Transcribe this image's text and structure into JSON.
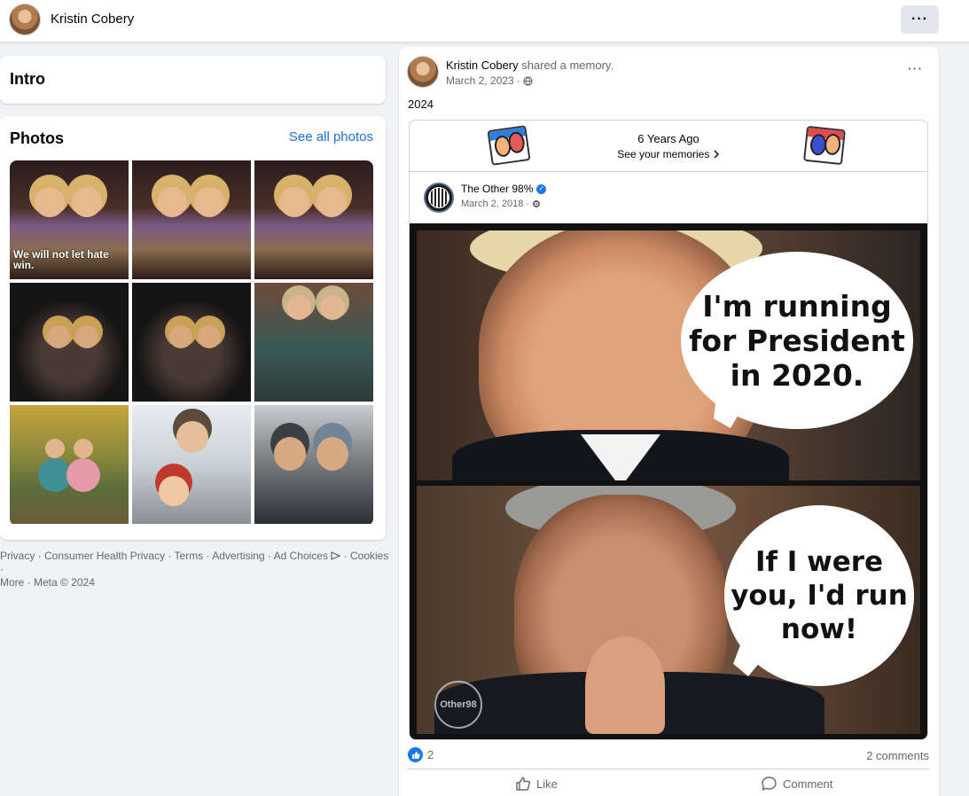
{
  "header": {
    "profile_name": "Kristin Cobery",
    "more_label": "···"
  },
  "intro": {
    "title": "Intro"
  },
  "photos": {
    "title": "Photos",
    "see_all": "See all photos",
    "items": [
      {
        "caption": "We will not let hate win."
      },
      {
        "caption": ""
      },
      {
        "caption": ""
      },
      {
        "caption": ""
      },
      {
        "caption": ""
      },
      {
        "caption": ""
      },
      {
        "caption": ""
      },
      {
        "caption": ""
      },
      {
        "caption": ""
      }
    ]
  },
  "footer": {
    "links": [
      "Privacy",
      "Consumer Health Privacy",
      "Terms",
      "Advertising",
      "Ad Choices",
      "Cookies",
      "More"
    ],
    "copyright": "Meta © 2024"
  },
  "post": {
    "author": "Kristin Cobery",
    "action": "shared a memory.",
    "date": "March 2, 2023",
    "audience_icon": "globe-icon",
    "text": "2024",
    "more_label": "···",
    "memory": {
      "years_ago": "6 Years Ago",
      "see_memories": "See your memories",
      "shared_page": "The Other 98%",
      "shared_date": "March 2, 2018",
      "meme": {
        "top_bubble": "I'm running for President in 2020.",
        "bottom_bubble": "If I were you, I'd run now!",
        "watermark": "Other98"
      }
    },
    "like_count": "2",
    "comments": "2 comments",
    "like_label": "Like",
    "comment_label": "Comment"
  },
  "colors": {
    "link": "#216fdb",
    "facebook_blue": "#1877f2",
    "background": "#f0f2f5",
    "muted_text": "#65676b"
  }
}
